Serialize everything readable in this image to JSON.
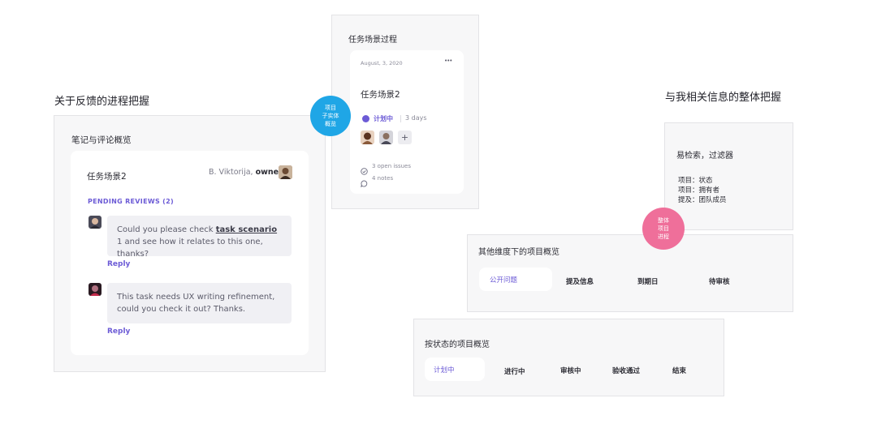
{
  "left": {
    "heading": "关于反馈的进程把握",
    "panel_title": "笔记与评论概览",
    "card": {
      "task": "任务场景2",
      "owner_name": "B. Viktorija, ",
      "owner_role": "owner",
      "pending": "PENDING REVIEWS (2)",
      "comment1": {
        "text_a": "Could you please check ",
        "text_link": "task scenario",
        "text_b": " 1 and see how it relates to this one, thanks?",
        "reply": "Reply"
      },
      "comment2": {
        "text": "This task needs UX writing refinement, could you check it out? Thanks.",
        "reply": "Reply"
      }
    }
  },
  "blue_badge": {
    "line1": "项目",
    "line2": "子实体",
    "line3": "概览",
    "color": "#1fa6e6"
  },
  "middle": {
    "panel_title": "任务场景过程",
    "card": {
      "date": "August, 3, 2020",
      "more": "•••",
      "task": "任务场景2",
      "status": "计划中",
      "duration": "3 days",
      "add": "+",
      "issues": "3 open issues",
      "notes": "4 notes"
    }
  },
  "right": {
    "heading": "与我相关信息的整体把握",
    "filter_title": "易检索，过滤器",
    "filter_items": [
      "项目：状态",
      "项目：拥有者",
      "提及：团队成员"
    ],
    "pink_badge": {
      "line1": "整体",
      "line2": "项目",
      "line3": "进程",
      "color": "#ef6f9a"
    },
    "dims": {
      "title": "其他维度下的项目概览",
      "tabs": [
        "公开问题",
        "提及信息",
        "到期日",
        "待审核"
      ]
    }
  },
  "status_panel": {
    "title": "按状态的项目概览",
    "tabs": [
      "计划中",
      "进行中",
      "审核中",
      "验收通过",
      "结束"
    ]
  },
  "colors": {
    "accent": "#6c5bd6",
    "panel_bg": "#f7f7f8"
  }
}
